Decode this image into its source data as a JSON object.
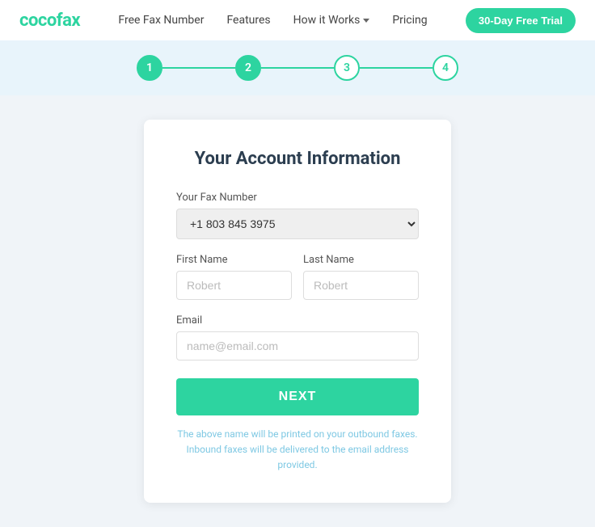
{
  "brand": {
    "logo": "cocofax"
  },
  "nav": {
    "items": [
      {
        "id": "free-fax-number",
        "label": "Free Fax Number"
      },
      {
        "id": "features",
        "label": "Features"
      },
      {
        "id": "how-it-works",
        "label": "How it Works"
      },
      {
        "id": "pricing",
        "label": "Pricing"
      }
    ],
    "cta_label": "30-Day Free Trial"
  },
  "progress": {
    "steps": [
      {
        "number": "1",
        "state": "active"
      },
      {
        "number": "2",
        "state": "active"
      },
      {
        "number": "3",
        "state": "inactive"
      },
      {
        "number": "4",
        "state": "inactive"
      }
    ]
  },
  "form": {
    "title": "Your Account Information",
    "fax_label": "Your Fax Number",
    "fax_value": "+1 803 845 3975",
    "first_name_label": "First Name",
    "first_name_placeholder": "Robert",
    "last_name_label": "Last Name",
    "last_name_placeholder": "Robert",
    "email_label": "Email",
    "email_placeholder": "name@email.com",
    "next_button": "NEXT",
    "disclaimer_line1": "The above name will be printed on your outbound faxes.",
    "disclaimer_line2": "Inbound faxes will be delivered to the email address provided."
  }
}
